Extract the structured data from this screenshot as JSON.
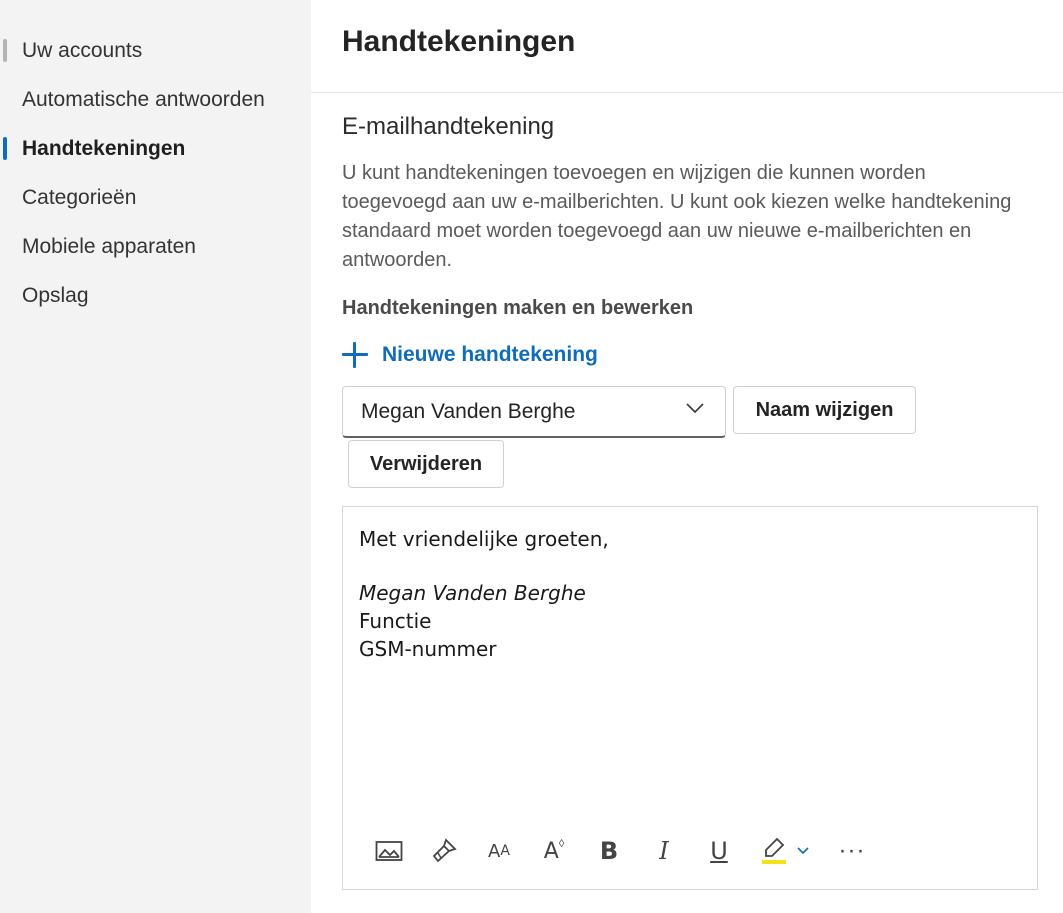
{
  "sidebar": {
    "items": [
      {
        "label": "Uw accounts"
      },
      {
        "label": "Automatische antwoorden"
      },
      {
        "label": "Handtekeningen"
      },
      {
        "label": "Categorieën"
      },
      {
        "label": "Mobiele apparaten"
      },
      {
        "label": "Opslag"
      }
    ],
    "active_item": "Handtekeningen"
  },
  "header": {
    "title": "Handtekeningen"
  },
  "main": {
    "section_title": "E-mailhandtekening",
    "description": "U kunt handtekeningen toevoegen en wijzigen die kunnen worden toegevoegd aan uw e-mailberichten. U kunt ook kiezen welke handtekening standaard moet worden toegevoegd aan uw nieuwe e-mailberichten en antwoorden.",
    "sub_heading": "Handtekeningen maken en bewerken",
    "new_signature_label": "Nieuwe handtekening",
    "signature_select": {
      "selected": "Megan Vanden Berghe"
    },
    "rename_label": "Naam wijzigen",
    "delete_label": "Verwijderen",
    "editor": {
      "line1": "Met vriendelijke groeten,",
      "line2": "Megan Vanden Berghe",
      "line3": "Functie",
      "line4": "GSM-nummer"
    },
    "toolbar": {
      "icons": [
        "image-icon",
        "format-painter-icon",
        "font-size-icon",
        "superscript-icon",
        "bold-icon",
        "italic-icon",
        "underline-icon",
        "highlight-icon",
        "more-icon"
      ]
    }
  },
  "colors": {
    "accent": "#0f6cbd",
    "sidebar_bg": "#f3f3f3",
    "highlight": "#f2e21c"
  }
}
